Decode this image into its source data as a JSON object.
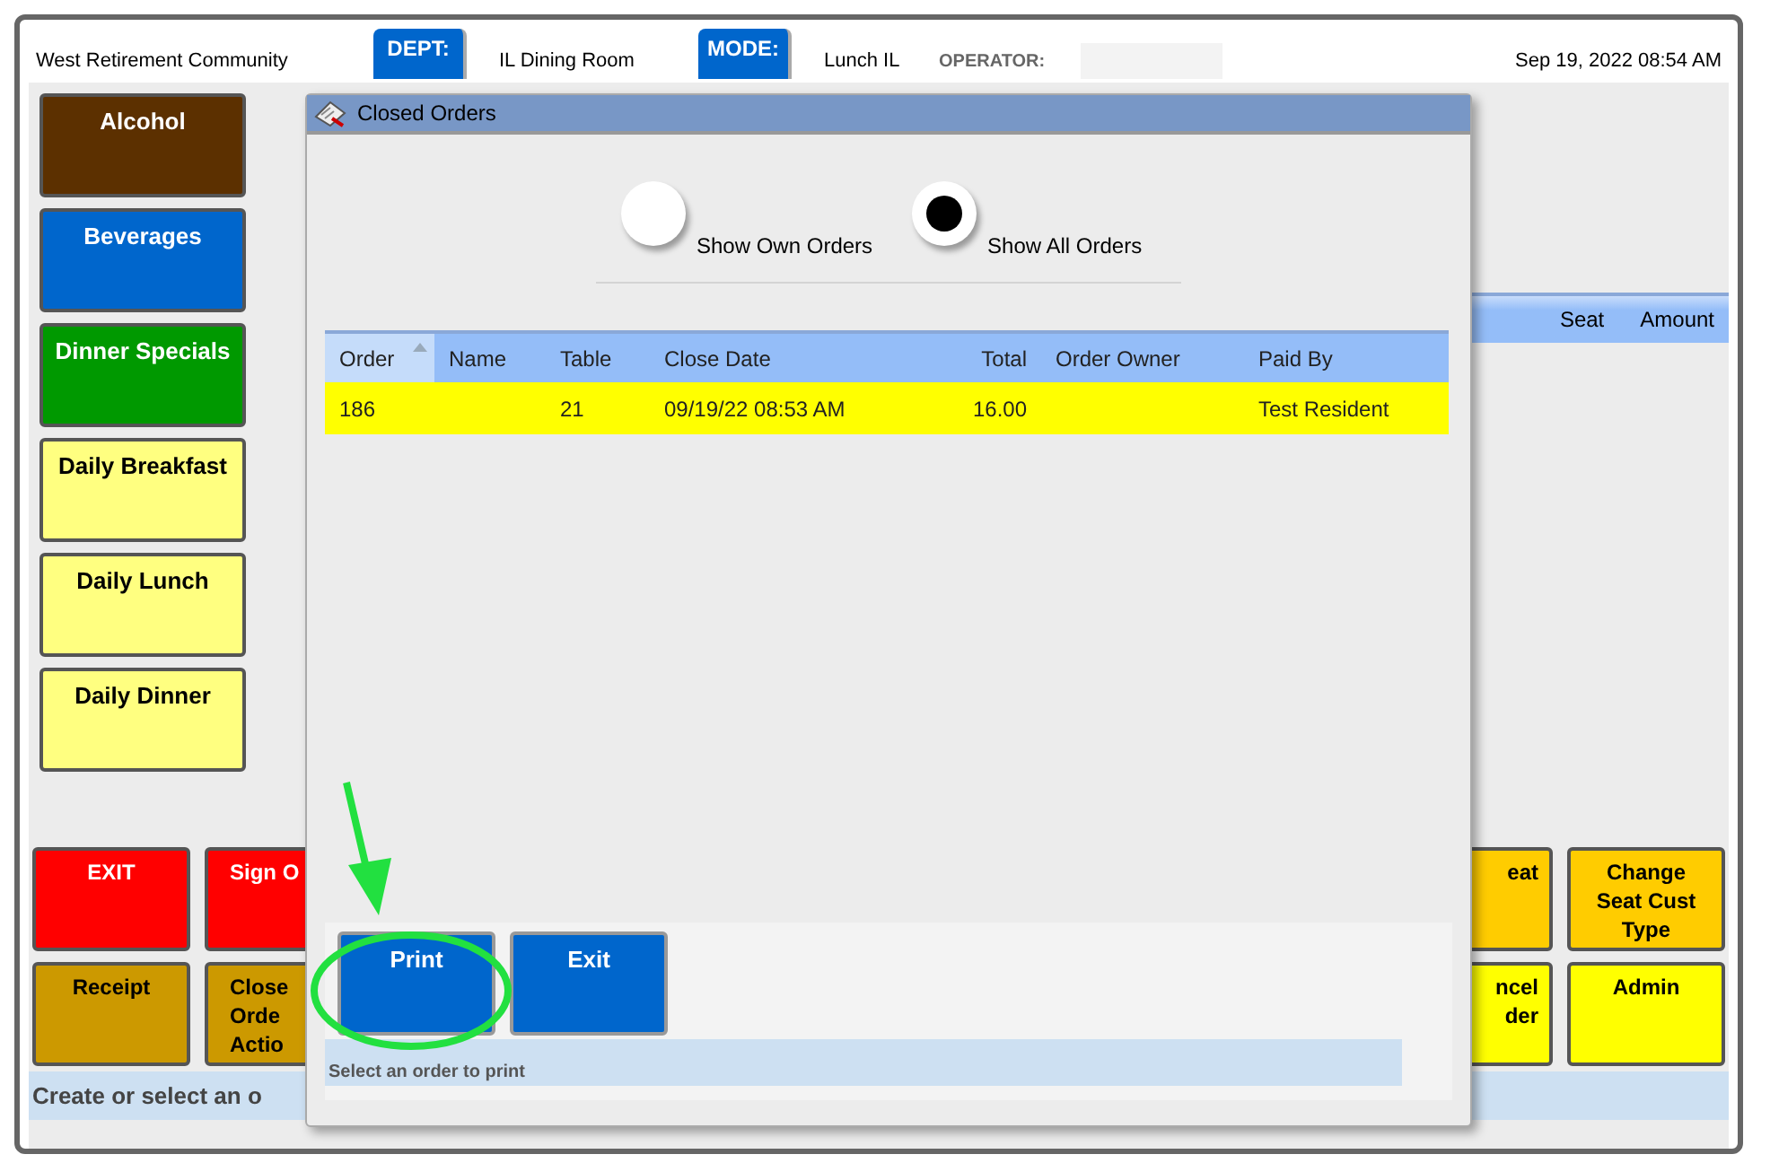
{
  "header": {
    "facility": "West Retirement Community",
    "dept_label": "DEPT:",
    "dept": "IL Dining Room",
    "mode_label": "MODE:",
    "mode": "Lunch IL",
    "operator_label": "OPERATOR:",
    "datetime": "Sep 19, 2022 08:54 AM"
  },
  "categories": [
    {
      "label": "Alcohol",
      "color": "#5c3000"
    },
    {
      "label": "Beverages",
      "color": "#0066cc"
    },
    {
      "label": "Dinner Specials",
      "color": "#009900"
    },
    {
      "label": "Daily Breakfast",
      "color": "#ffff80"
    },
    {
      "label": "Daily Lunch",
      "color": "#ffff80"
    },
    {
      "label": "Daily Dinner",
      "color": "#ffff80"
    }
  ],
  "order_panel": {
    "columns": [
      "Seat",
      "Amount"
    ]
  },
  "action_buttons_left": [
    [
      {
        "label": "EXIT",
        "color": "#ff0000"
      },
      {
        "label": "Sign O",
        "color": "#ff0000"
      }
    ],
    [
      {
        "label": "Receipt",
        "color": "#cc9900"
      },
      {
        "label": "Close\nOrde\nActio",
        "color": "#cc9900"
      }
    ]
  ],
  "action_buttons_right": [
    [
      {
        "label": "eat",
        "color": "#ffcc00"
      },
      {
        "label": "Change\nSeat Cust\nType",
        "color": "#ffcc00"
      }
    ],
    [
      {
        "label": "ncel\nder",
        "color": "#ffff00"
      },
      {
        "label": "Admin",
        "color": "#ffff00"
      }
    ]
  ],
  "status_bar": "Create or select an o",
  "dialog": {
    "title": "Closed Orders",
    "filters": [
      {
        "label": "Show Own Orders",
        "selected": false
      },
      {
        "label": "Show All Orders",
        "selected": true
      }
    ],
    "table": {
      "columns": [
        {
          "label": "Order",
          "sorted": true
        },
        {
          "label": "Name",
          "sorted": false
        },
        {
          "label": "Table",
          "sorted": false
        },
        {
          "label": "Close Date",
          "sorted": false
        },
        {
          "label": "Total",
          "sorted": false
        },
        {
          "label": "Order Owner",
          "sorted": false
        },
        {
          "label": "Paid By",
          "sorted": false
        }
      ],
      "rows": [
        {
          "selected": true,
          "cells": [
            "186",
            "",
            "21",
            "09/19/22 08:53 AM",
            "16.00",
            "",
            "Test Resident"
          ]
        }
      ]
    },
    "buttons": [
      "Print",
      "Exit"
    ],
    "message": "Select an order to print"
  }
}
